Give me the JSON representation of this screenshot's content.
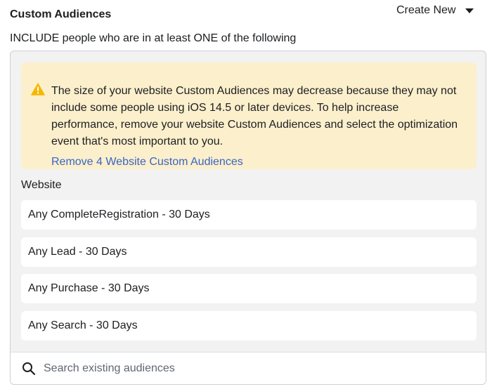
{
  "header": {
    "title": "Custom Audiences",
    "create_new_label": "Create New"
  },
  "include_text": "INCLUDE people who are in at least ONE of the following",
  "warning": {
    "icon": "warning-triangle-icon",
    "color": "#f5b800",
    "message": "The size of your website Custom Audiences may decrease because they may not include some people using iOS 14.5 or later devices. To help increase performance, remove your website Custom Audiences and select the optimization event that's most important to you.",
    "link_label": "Remove 4 Website Custom Audiences"
  },
  "section_label": "Website",
  "audiences": [
    {
      "label": "Any CompleteRegistration - 30 Days"
    },
    {
      "label": "Any Lead - 30 Days"
    },
    {
      "label": "Any Purchase - 30 Days"
    },
    {
      "label": "Any Search - 30 Days"
    }
  ],
  "search": {
    "placeholder": "Search existing audiences",
    "value": ""
  },
  "colors": {
    "link": "#3865c7",
    "warning_bg": "#fcefcc",
    "panel_bg": "#f2f2f2"
  }
}
